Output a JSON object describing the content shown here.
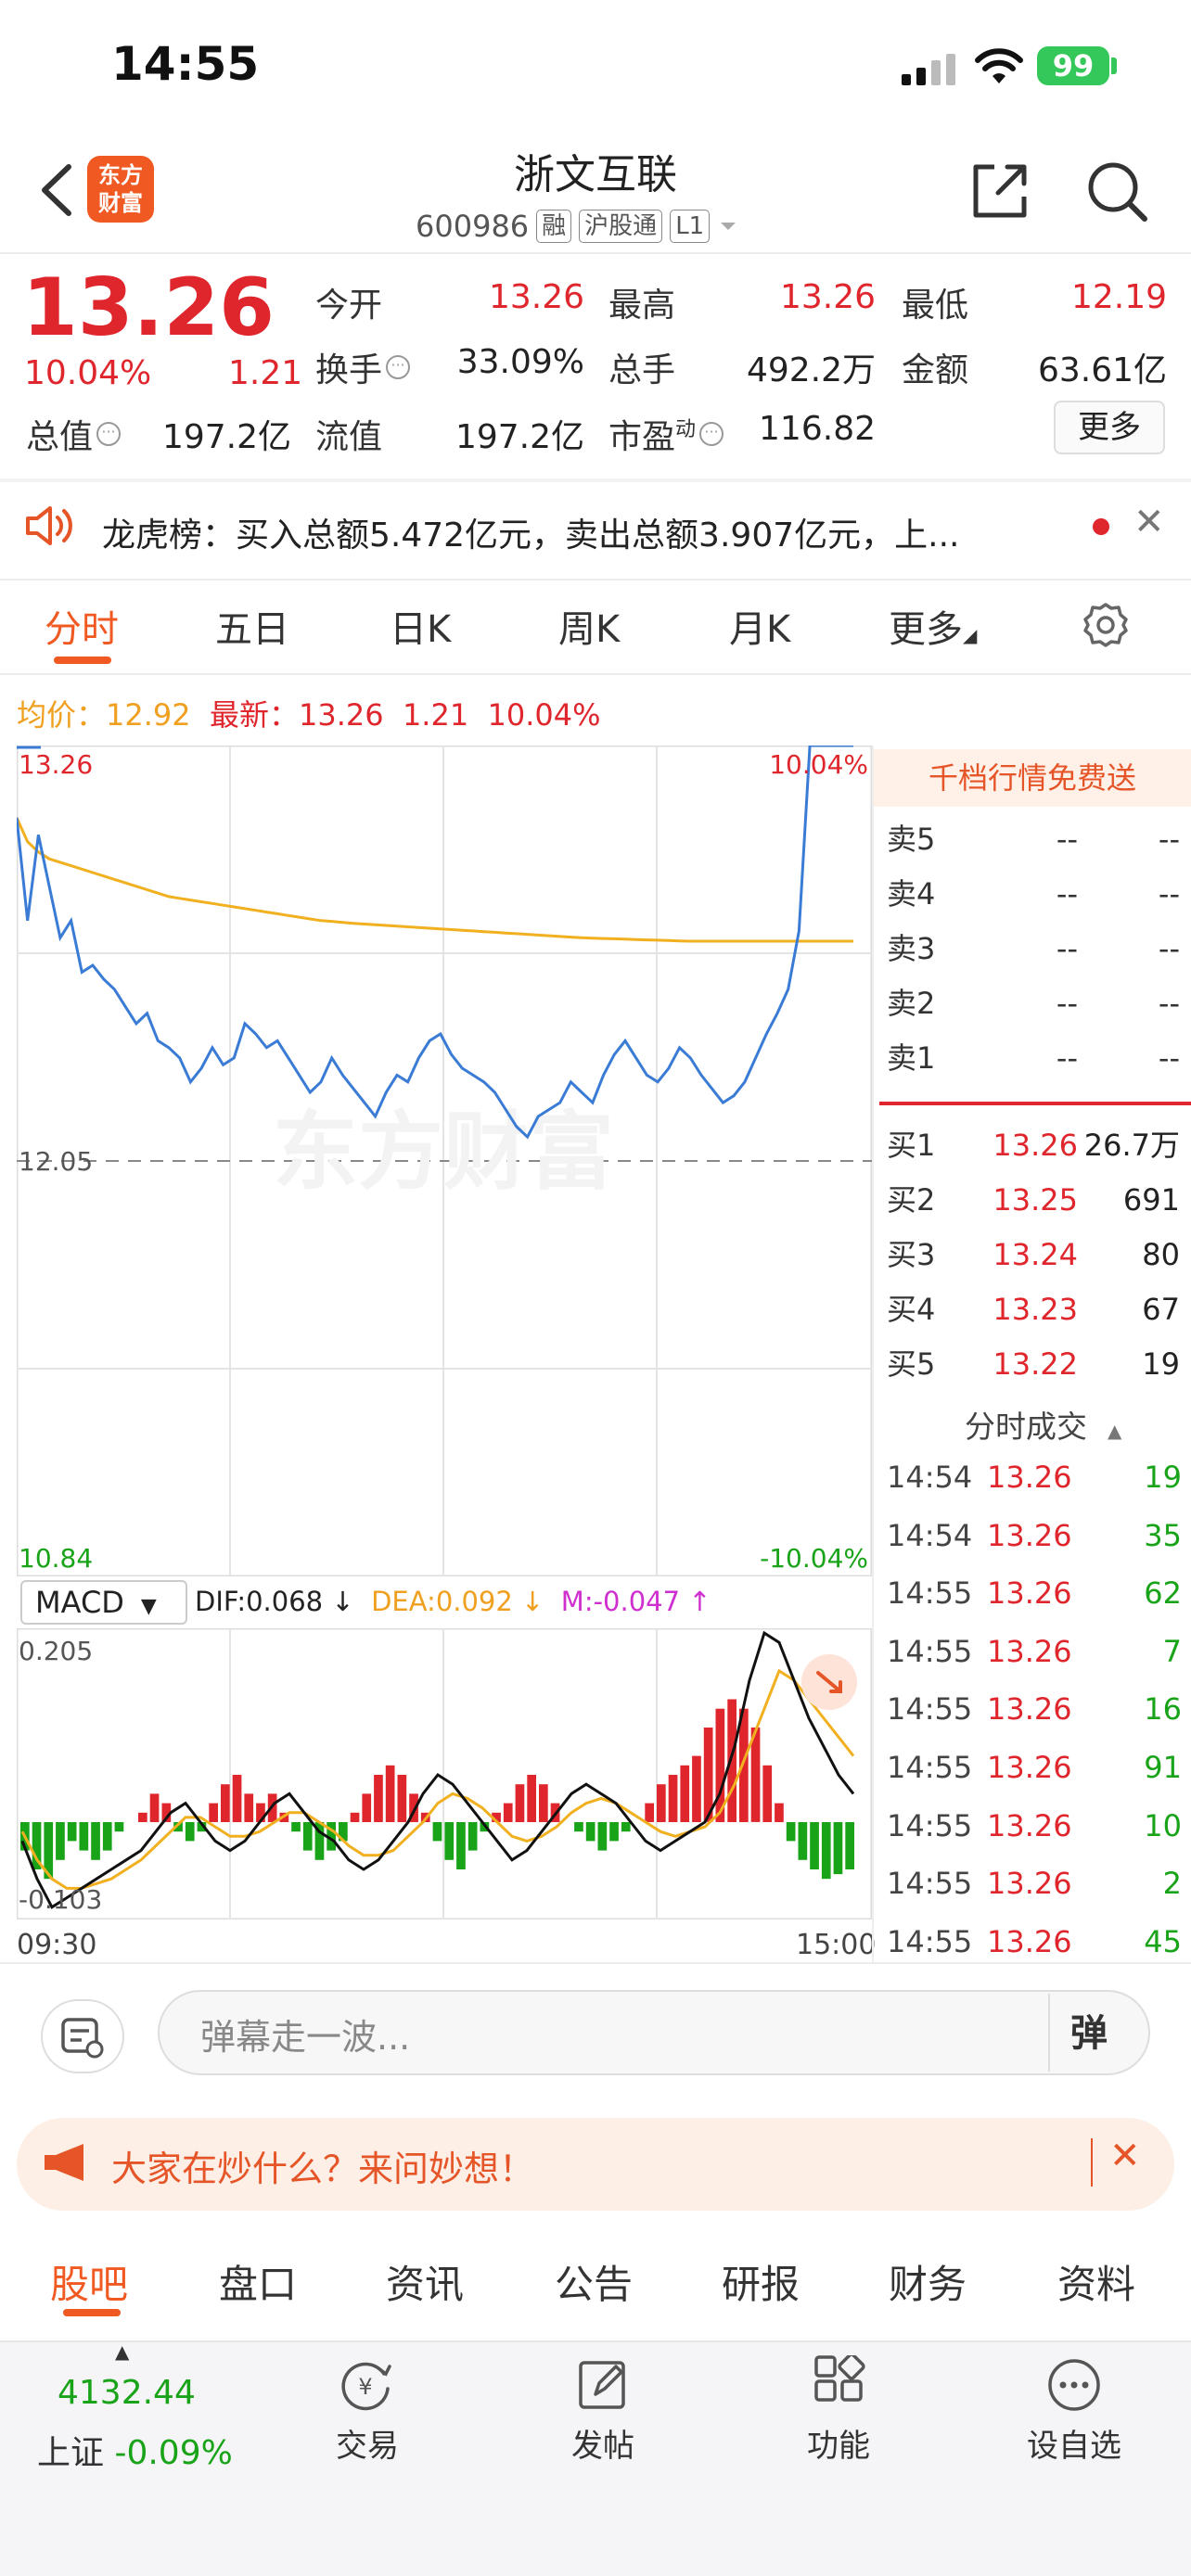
{
  "status_bar": {
    "time": "14:55",
    "battery": "99"
  },
  "header": {
    "title": "浙文互联",
    "code": "600986",
    "tags": [
      "融",
      "沪股通",
      "L1"
    ],
    "logo_line1": "东方",
    "logo_line2": "财富"
  },
  "quote": {
    "price": "13.26",
    "change_pct": "10.04%",
    "change": "1.21",
    "fields": [
      {
        "label": "今开",
        "value": "13.26",
        "color": "red"
      },
      {
        "label": "最高",
        "value": "13.26",
        "color": "red"
      },
      {
        "label": "最低",
        "value": "12.19",
        "color": "red"
      },
      {
        "label": "换手",
        "value": "33.09%",
        "color": "black"
      },
      {
        "label": "总手",
        "value": "492.2万",
        "color": "black"
      },
      {
        "label": "金额",
        "value": "63.61亿",
        "color": "black"
      },
      {
        "label": "总值",
        "value": "197.2亿",
        "color": "black"
      },
      {
        "label": "流值",
        "value": "197.2亿",
        "color": "black"
      },
      {
        "label": "市盈",
        "label_sup": "动",
        "value": "116.82",
        "color": "black"
      }
    ],
    "more_label": "更多"
  },
  "dragon_tiger": {
    "text": "龙虎榜：买入总额5.472亿元，卖出总额3.907亿元，上..."
  },
  "chart_tabs": [
    "分时",
    "五日",
    "日K",
    "周K",
    "月K",
    "更多"
  ],
  "legend": {
    "avg_label": "均价：",
    "avg_value": "12.92",
    "latest_label": "最新：",
    "latest_value": "13.26",
    "latest_change": "1.21",
    "latest_pct": "10.04%"
  },
  "chart_data": {
    "type": "line",
    "title": "",
    "price_axis": {
      "top": "13.26",
      "mid": "12.05",
      "bottom": "10.84",
      "top_pct": "10.04%",
      "bottom_pct": "-10.04%"
    },
    "time_axis": {
      "start": "09:30",
      "end": "15:00"
    },
    "watermark": "东方财富",
    "series": [
      {
        "name": "price",
        "color": "#3a7bd5",
        "values": [
          13.05,
          12.75,
          13.0,
          12.85,
          12.7,
          12.75,
          12.6,
          12.62,
          12.58,
          12.55,
          12.5,
          12.45,
          12.48,
          12.4,
          12.38,
          12.35,
          12.28,
          12.32,
          12.38,
          12.33,
          12.35,
          12.45,
          12.42,
          12.38,
          12.4,
          12.35,
          12.3,
          12.25,
          12.28,
          12.35,
          12.3,
          12.26,
          12.22,
          12.18,
          12.25,
          12.3,
          12.28,
          12.35,
          12.4,
          12.42,
          12.36,
          12.32,
          12.3,
          12.28,
          12.25,
          12.2,
          12.15,
          12.12,
          12.18,
          12.2,
          12.22,
          12.28,
          12.25,
          12.22,
          12.3,
          12.36,
          12.4,
          12.35,
          12.3,
          12.28,
          12.32,
          12.38,
          12.35,
          12.3,
          12.26,
          12.22,
          12.24,
          12.28,
          12.35,
          12.42,
          12.48,
          12.55,
          12.72,
          13.26,
          13.26,
          13.26,
          13.26,
          13.26
        ]
      },
      {
        "name": "avg",
        "color": "#f0b020",
        "values": [
          13.05,
          12.98,
          12.95,
          12.93,
          12.92,
          12.91,
          12.9,
          12.89,
          12.88,
          12.87,
          12.86,
          12.85,
          12.84,
          12.83,
          12.82,
          12.815,
          12.81,
          12.805,
          12.8,
          12.795,
          12.79,
          12.785,
          12.78,
          12.775,
          12.77,
          12.765,
          12.76,
          12.755,
          12.75,
          12.748,
          12.745,
          12.742,
          12.74,
          12.738,
          12.736,
          12.734,
          12.732,
          12.73,
          12.728,
          12.726,
          12.724,
          12.722,
          12.72,
          12.718,
          12.716,
          12.714,
          12.712,
          12.71,
          12.708,
          12.706,
          12.704,
          12.702,
          12.7,
          12.699,
          12.698,
          12.697,
          12.696,
          12.695,
          12.694,
          12.693,
          12.692,
          12.691,
          12.69,
          12.69,
          12.69,
          12.69,
          12.69,
          12.69,
          12.69,
          12.69,
          12.69,
          12.69,
          12.69,
          12.69,
          12.69,
          12.69,
          12.69,
          12.69
        ]
      }
    ],
    "ylim": [
      10.84,
      13.26
    ],
    "macd": {
      "label": "MACD",
      "dif": "DIF:0.068 ↓",
      "dea": "DEA:0.092 ↓",
      "m": "M:-0.047 ↑",
      "axis_top": "0.205",
      "axis_bottom": "-0.103",
      "ylim": [
        -0.103,
        0.205
      ],
      "hist": [
        -0.03,
        -0.05,
        -0.06,
        -0.04,
        -0.02,
        -0.03,
        -0.04,
        -0.03,
        -0.01,
        0.0,
        0.01,
        0.03,
        0.02,
        -0.01,
        -0.02,
        -0.01,
        0.02,
        0.04,
        0.05,
        0.03,
        0.02,
        0.03,
        0.01,
        -0.01,
        -0.03,
        -0.04,
        -0.03,
        -0.02,
        0.01,
        0.03,
        0.05,
        0.06,
        0.05,
        0.03,
        0.01,
        -0.02,
        -0.04,
        -0.05,
        -0.03,
        -0.01,
        0.01,
        0.02,
        0.04,
        0.05,
        0.04,
        0.02,
        0.0,
        -0.01,
        -0.02,
        -0.03,
        -0.02,
        -0.01,
        0.0,
        0.02,
        0.04,
        0.05,
        0.06,
        0.07,
        0.1,
        0.12,
        0.13,
        0.12,
        0.1,
        0.06,
        0.02,
        -0.02,
        -0.04,
        -0.05,
        -0.06,
        -0.055,
        -0.05
      ],
      "dif_line": [
        -0.02,
        -0.06,
        -0.09,
        -0.08,
        -0.07,
        -0.06,
        -0.05,
        -0.04,
        -0.03,
        -0.01,
        0.01,
        0.02,
        0.0,
        -0.02,
        -0.03,
        -0.02,
        0.0,
        0.02,
        0.03,
        0.01,
        -0.01,
        -0.02,
        -0.04,
        -0.05,
        -0.04,
        -0.02,
        0.0,
        0.03,
        0.05,
        0.04,
        0.02,
        0.0,
        -0.02,
        -0.04,
        -0.03,
        -0.01,
        0.01,
        0.03,
        0.04,
        0.03,
        0.02,
        0.0,
        -0.02,
        -0.03,
        -0.02,
        -0.01,
        0.0,
        0.03,
        0.08,
        0.15,
        0.2,
        0.19,
        0.15,
        0.11,
        0.08,
        0.05,
        0.03
      ],
      "dea_line": [
        -0.01,
        -0.04,
        -0.06,
        -0.07,
        -0.07,
        -0.065,
        -0.06,
        -0.05,
        -0.04,
        -0.025,
        -0.01,
        0.005,
        0.005,
        -0.005,
        -0.015,
        -0.015,
        -0.01,
        0.0,
        0.01,
        0.01,
        0.0,
        -0.01,
        -0.025,
        -0.035,
        -0.035,
        -0.03,
        -0.015,
        0.0,
        0.02,
        0.03,
        0.025,
        0.015,
        0.0,
        -0.015,
        -0.02,
        -0.015,
        -0.005,
        0.01,
        0.02,
        0.025,
        0.02,
        0.01,
        0.0,
        -0.01,
        -0.015,
        -0.01,
        -0.005,
        0.01,
        0.04,
        0.08,
        0.12,
        0.16,
        0.15,
        0.13,
        0.11,
        0.09,
        0.07
      ]
    }
  },
  "order_book": {
    "banner": "千档行情免费送",
    "asks": [
      {
        "name": "卖5",
        "price": "--",
        "vol": "--"
      },
      {
        "name": "卖4",
        "price": "--",
        "vol": "--"
      },
      {
        "name": "卖3",
        "price": "--",
        "vol": "--"
      },
      {
        "name": "卖2",
        "price": "--",
        "vol": "--"
      },
      {
        "name": "卖1",
        "price": "--",
        "vol": "--"
      }
    ],
    "bids": [
      {
        "name": "买1",
        "price": "13.26",
        "vol": "26.7万"
      },
      {
        "name": "买2",
        "price": "13.25",
        "vol": "691"
      },
      {
        "name": "买3",
        "price": "13.24",
        "vol": "80"
      },
      {
        "name": "买4",
        "price": "13.23",
        "vol": "67"
      },
      {
        "name": "买5",
        "price": "13.22",
        "vol": "19"
      }
    ],
    "ticks_header": "分时成交",
    "ticks": [
      {
        "time": "14:54",
        "price": "13.26",
        "vol": "19"
      },
      {
        "time": "14:54",
        "price": "13.26",
        "vol": "35"
      },
      {
        "time": "14:55",
        "price": "13.26",
        "vol": "62"
      },
      {
        "time": "14:55",
        "price": "13.26",
        "vol": "7"
      },
      {
        "time": "14:55",
        "price": "13.26",
        "vol": "16"
      },
      {
        "time": "14:55",
        "price": "13.26",
        "vol": "91"
      },
      {
        "time": "14:55",
        "price": "13.26",
        "vol": "10"
      },
      {
        "time": "14:55",
        "price": "13.26",
        "vol": "2"
      },
      {
        "time": "14:55",
        "price": "13.26",
        "vol": "45"
      }
    ]
  },
  "danmu": {
    "placeholder": "弹幕走一波...",
    "send": "弹"
  },
  "ask_banner": {
    "text": "大家在炒什么？来问妙想！"
  },
  "bottom_tabs": [
    "股吧",
    "盘口",
    "资讯",
    "公告",
    "研报",
    "财务",
    "资料"
  ],
  "bottom_nav": {
    "index_value": "4132.44",
    "index_name": "上证",
    "index_change": "-0.09%",
    "items": [
      "交易",
      "发帖",
      "功能",
      "设自选"
    ]
  }
}
